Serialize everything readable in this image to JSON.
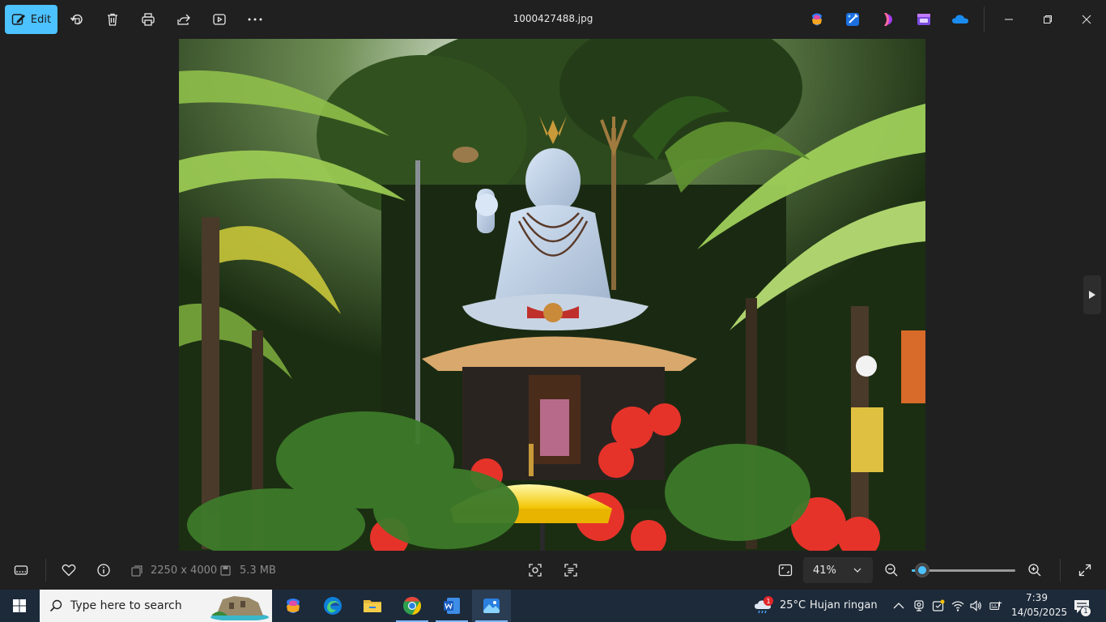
{
  "toolbar": {
    "edit_label": "Edit",
    "title": "1000427488.jpg"
  },
  "bottom": {
    "dimensions": "2250 x 4000",
    "file_size": "5.3 MB",
    "zoom_level": "41%",
    "zoom_fraction": 0.1
  },
  "taskbar": {
    "search_placeholder": "Type here to search",
    "weather_temp": "25°C",
    "weather_desc": "Hujan ringan",
    "weather_badge": "1",
    "time": "7:39",
    "date": "14/05/2025",
    "notification_count": "1"
  },
  "colors": {
    "accent": "#4cc2ff",
    "background": "#202020",
    "taskbar": "#1c2a3a"
  }
}
